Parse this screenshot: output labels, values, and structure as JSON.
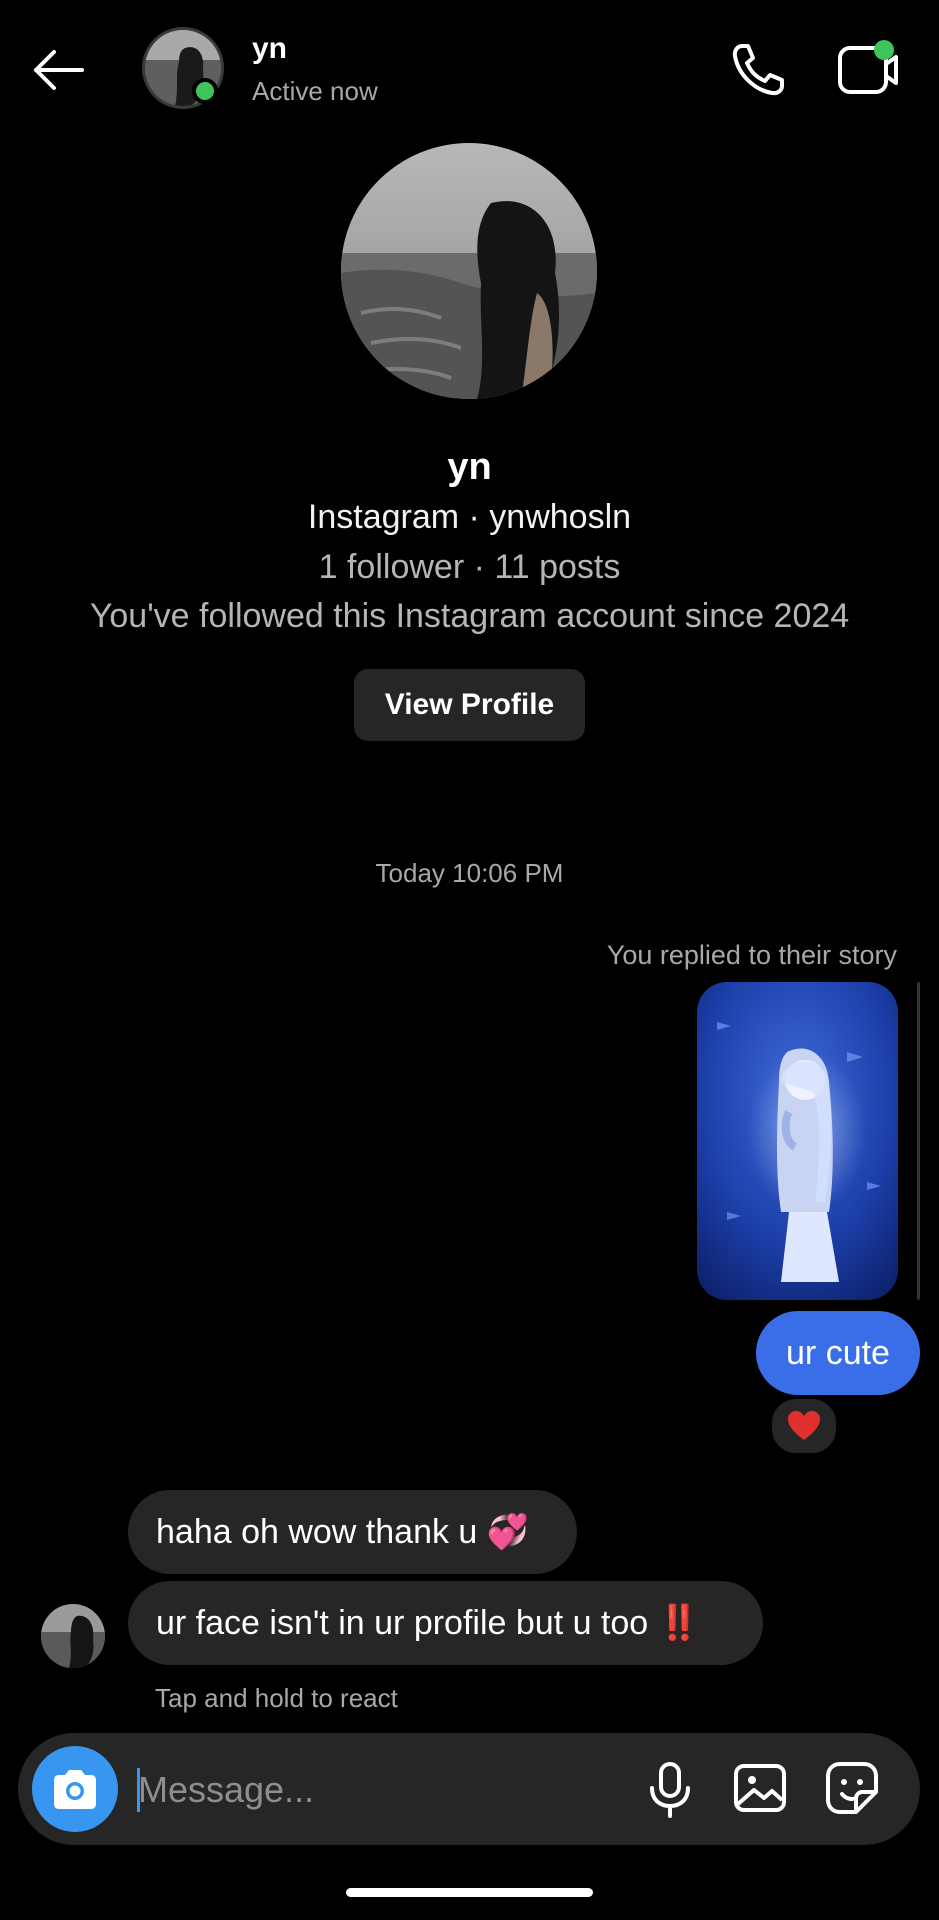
{
  "header": {
    "name": "yn",
    "status": "Active now"
  },
  "profile": {
    "name": "yn",
    "handle_line": "Instagram · ynwhosln",
    "stats_line": "1 follower · 11 posts",
    "follow_since": "You've followed this Instagram account since 2024",
    "view_profile_label": "View Profile"
  },
  "thread": {
    "timestamp": "Today 10:06 PM",
    "story_reply_note": "You replied to their story",
    "sent_message": "ur cute",
    "reaction": "❤️",
    "received": [
      {
        "text": "haha oh wow thank u 💞"
      },
      {
        "text": "ur face isn't in ur profile but u too ‼️"
      }
    ],
    "hint": "Tap and hold to react"
  },
  "composer": {
    "placeholder": "Message..."
  },
  "colors": {
    "background": "#000000",
    "bubble_outgoing": "#3a6ee8",
    "bubble_incoming": "#262626",
    "online": "#3ec45a",
    "camera_button": "#3797f0"
  },
  "icons": [
    "back-arrow-icon",
    "phone-icon",
    "video-camera-icon",
    "camera-icon",
    "microphone-icon",
    "gallery-icon",
    "sticker-icon"
  ]
}
